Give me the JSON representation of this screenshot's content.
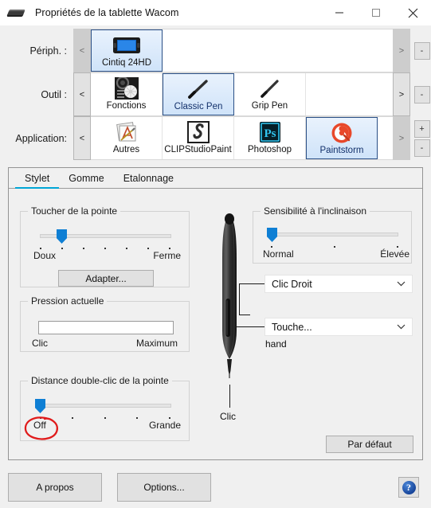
{
  "window": {
    "title": "Propriétés de la tablette Wacom",
    "icon": "wacom-tablet-icon",
    "minimize": "—",
    "maximize": "▢",
    "close": "✕"
  },
  "selectors": {
    "device": {
      "label": "Périph. :",
      "prev": "<",
      "next": ">",
      "prev_enabled": false,
      "next_enabled": false,
      "remove": "-",
      "items": [
        {
          "label": "Cintiq 24HD",
          "icon": "cintiq-tablet-icon",
          "selected": true
        }
      ]
    },
    "tool": {
      "label": "Outil :",
      "prev": "<",
      "next": ">",
      "prev_enabled": true,
      "next_enabled": true,
      "remove": "-",
      "items": [
        {
          "label": "Fonctions",
          "icon": "express-keys-icon",
          "selected": false
        },
        {
          "label": "Classic Pen",
          "icon": "classic-pen-icon",
          "selected": true
        },
        {
          "label": "Grip Pen",
          "icon": "grip-pen-icon",
          "selected": false
        }
      ]
    },
    "application": {
      "label": "Application:",
      "prev": "<",
      "next": ">",
      "prev_enabled": true,
      "next_enabled": false,
      "add": "+",
      "remove": "-",
      "items": [
        {
          "label": "Autres",
          "icon": "all-others-icon",
          "selected": false
        },
        {
          "label": "CLIPStudioPaint",
          "icon": "clip-studio-paint-icon",
          "selected": false
        },
        {
          "label": "Photoshop",
          "icon": "photoshop-icon",
          "selected": false
        },
        {
          "label": "Paintstorm",
          "icon": "paintstorm-icon",
          "selected": true
        }
      ]
    }
  },
  "tabs": [
    {
      "label": "Stylet",
      "active": true
    },
    {
      "label": "Gomme",
      "active": false
    },
    {
      "label": "Etalonnage",
      "active": false
    }
  ],
  "tip_feel": {
    "caption": "Toucher de la pointe",
    "min_label": "Doux",
    "max_label": "Ferme",
    "ticks": 7,
    "value_index": 1,
    "customize_button": "Adapter..."
  },
  "current_pressure": {
    "caption": "Pression actuelle",
    "min_label": "Clic",
    "max_label": "Maximum",
    "value_percent": 0
  },
  "double_click_distance": {
    "caption": "Distance double-clic de la pointe",
    "min_label": "Off",
    "max_label": "Grande",
    "ticks": 5,
    "value_index": 0,
    "annotation": "red-circle-around-off"
  },
  "tilt_sensitivity": {
    "caption": "Sensibilité à l'inclinaison",
    "min_label": "Normal",
    "max_label": "Élevée",
    "ticks": 3,
    "value_index": 0
  },
  "pen_buttons": {
    "upper": {
      "value": "Clic Droit",
      "caret": "⌄"
    },
    "lower": {
      "value": "Touche...",
      "caret": "⌄"
    },
    "lower_note": "hand",
    "tip_label": "Clic"
  },
  "panel_buttons": {
    "defaults": "Par défaut"
  },
  "footer": {
    "about": "A propos",
    "options": "Options...",
    "help": "?"
  },
  "colors": {
    "accent": "#00a6d6",
    "slider": "#0f7fd4",
    "selection_border": "#2a4f86",
    "annotation": "#e01b1b"
  }
}
